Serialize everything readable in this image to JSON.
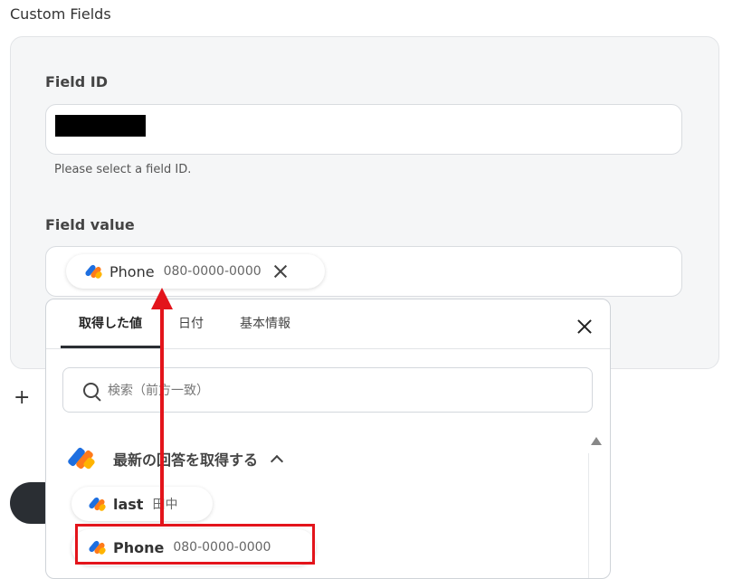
{
  "section_title": "Custom Fields",
  "field_id": {
    "label": "Field ID",
    "help": "Please select a field ID."
  },
  "field_value": {
    "label": "Field value",
    "chip": {
      "name": "Phone",
      "value": "080-0000-0000"
    }
  },
  "add_icon": "+",
  "popup": {
    "tabs": [
      "取得した値",
      "日付",
      "基本情報"
    ],
    "search_placeholder": "検索（前方一致）",
    "group_title": "最新の回答を取得する",
    "items": [
      {
        "name": "last",
        "value": "田中"
      },
      {
        "name": "Phone",
        "value": "080-0000-0000"
      }
    ]
  },
  "colors": {
    "accent_red": "#e3141b",
    "dark": "#2a2e33"
  }
}
